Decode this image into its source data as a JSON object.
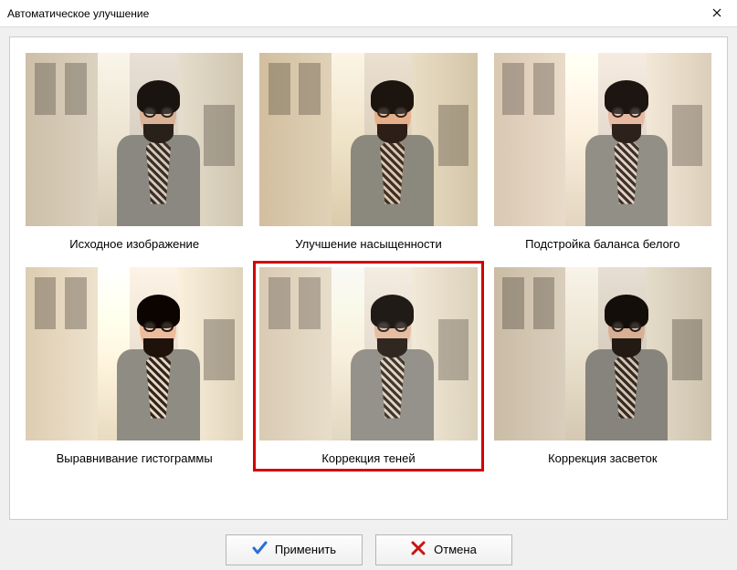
{
  "window": {
    "title": "Автоматическое улучшение"
  },
  "thumbnails": [
    {
      "label": "Исходное изображение",
      "selected": false,
      "filter": ""
    },
    {
      "label": "Улучшение насыщенности",
      "selected": false,
      "filter": "sat"
    },
    {
      "label": "Подстройка баланса белого",
      "selected": false,
      "filter": "wb"
    },
    {
      "label": "Выравнивание гистограммы",
      "selected": false,
      "filter": "hist"
    },
    {
      "label": "Коррекция теней",
      "selected": true,
      "filter": "shadow"
    },
    {
      "label": "Коррекция засветок",
      "selected": false,
      "filter": "highlight"
    }
  ],
  "buttons": {
    "apply": "Применить",
    "cancel": "Отмена"
  }
}
